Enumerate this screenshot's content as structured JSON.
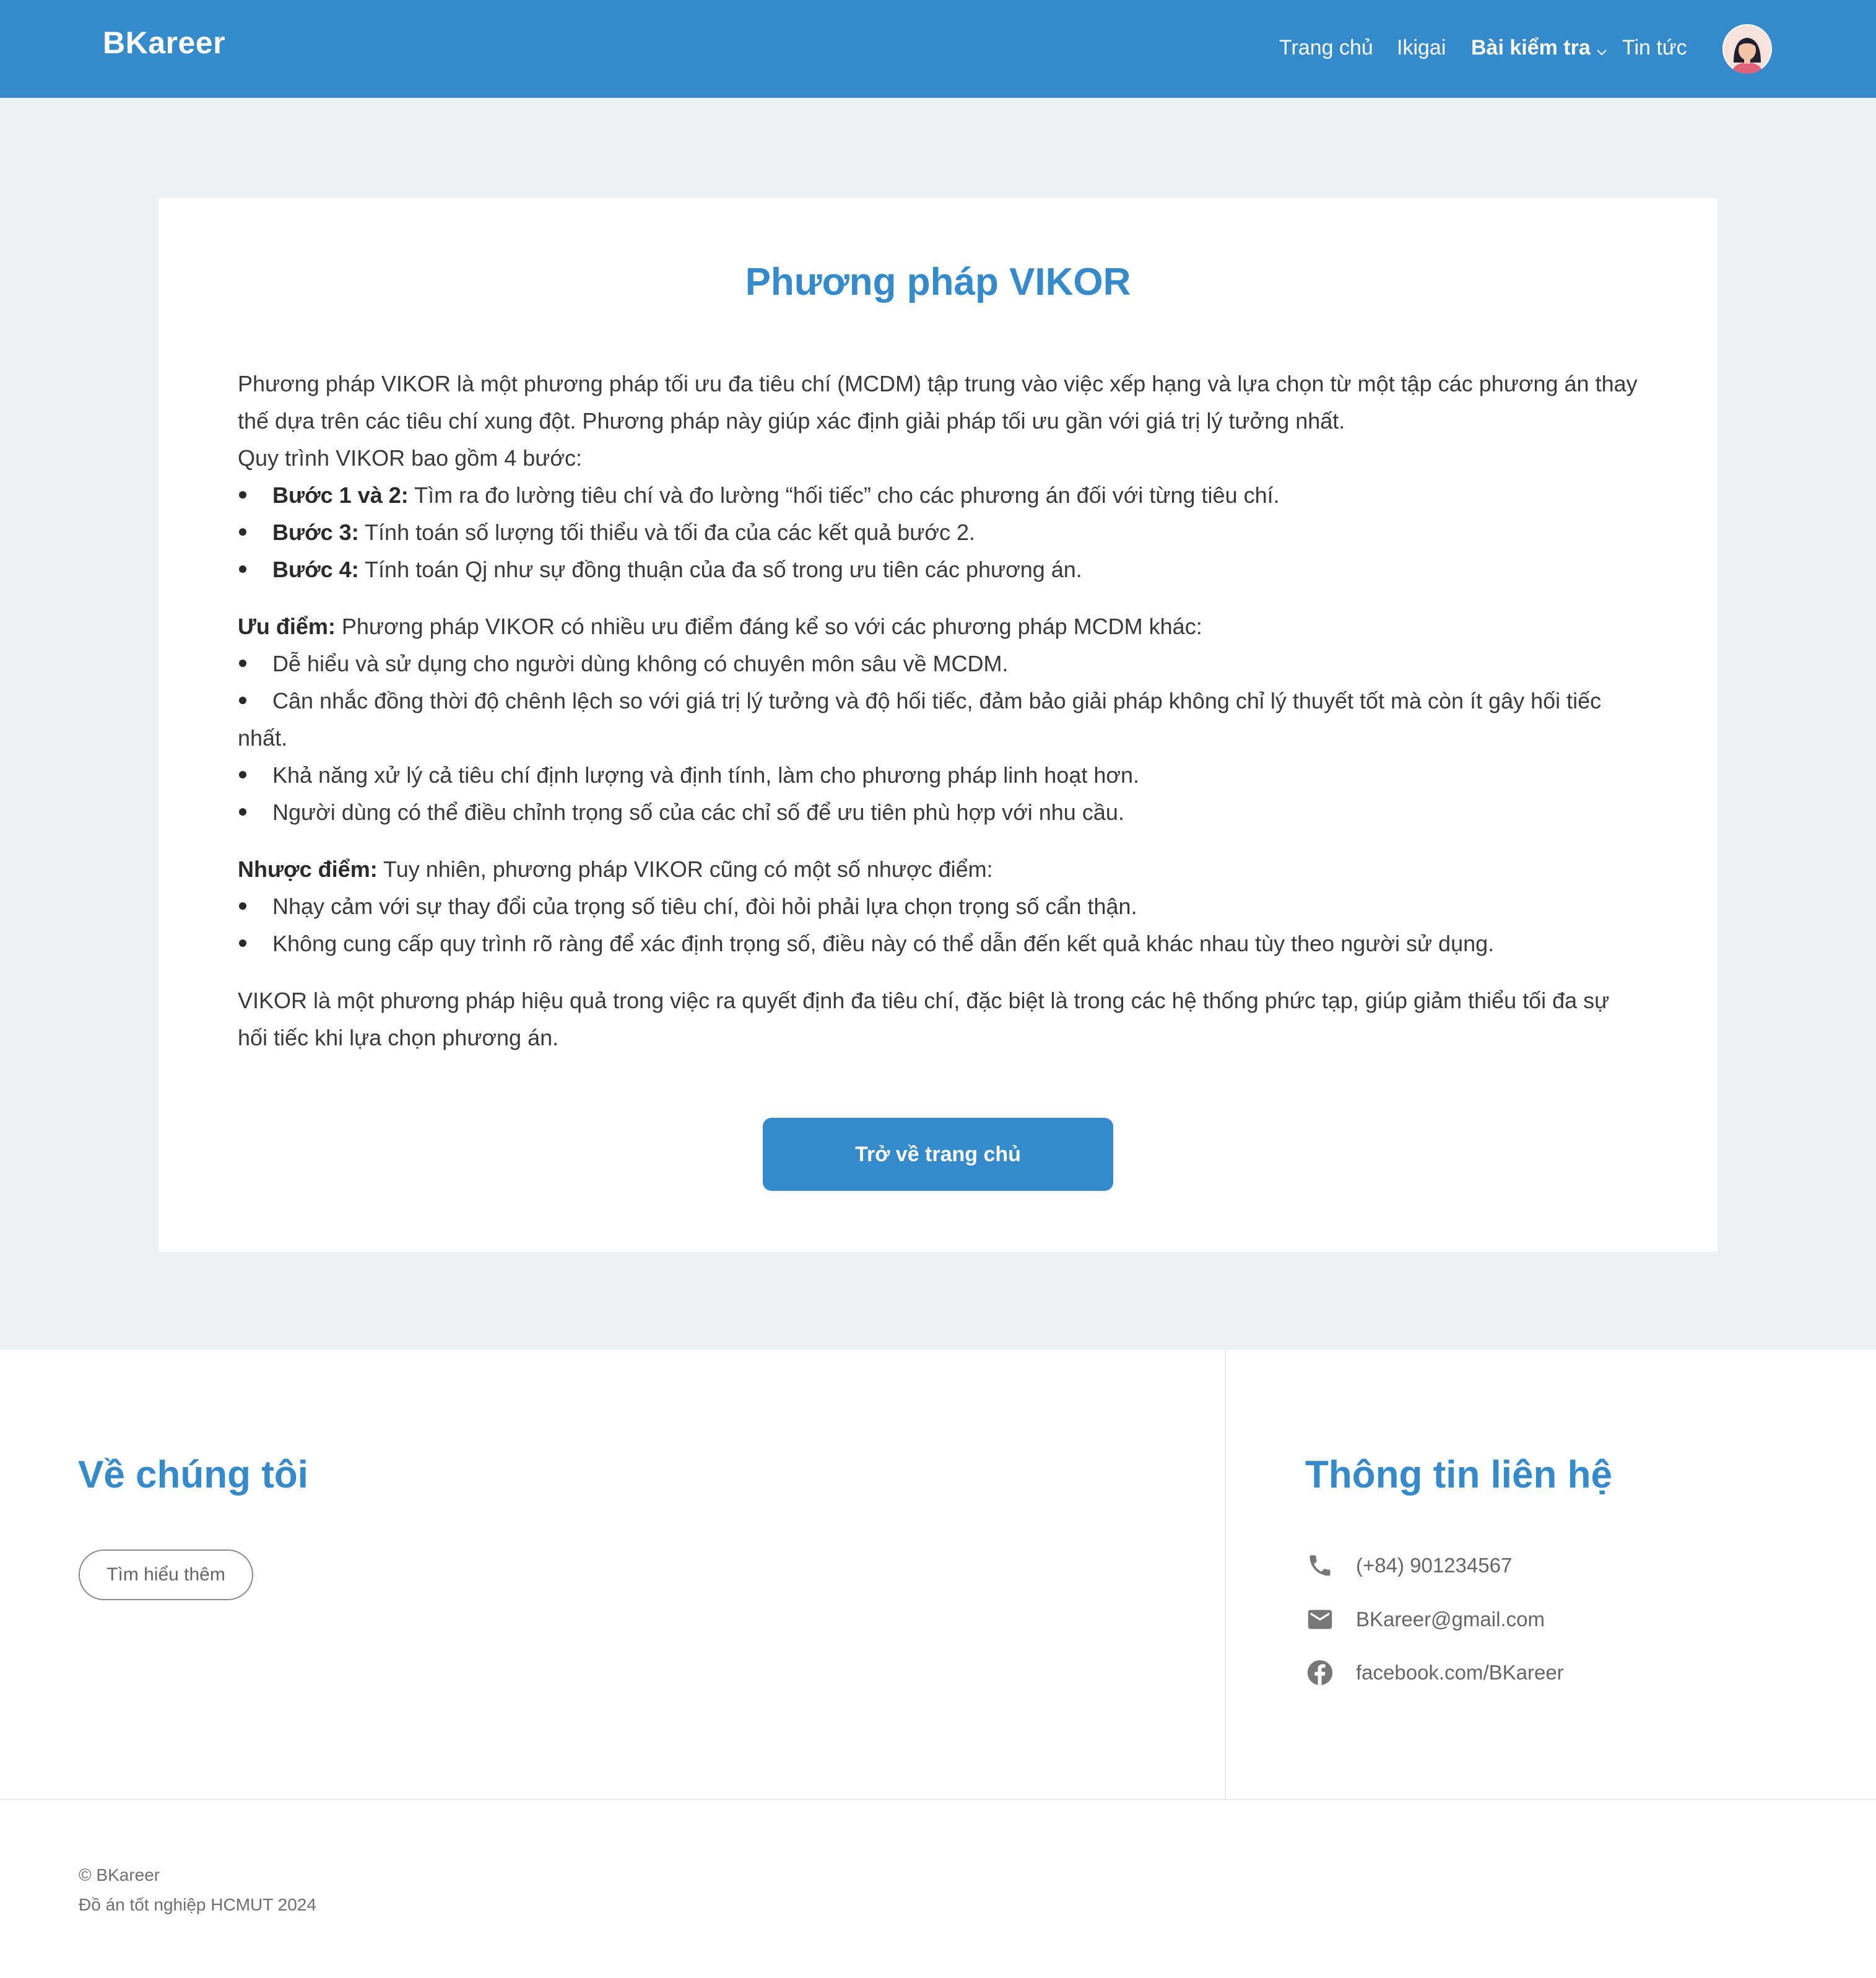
{
  "header": {
    "logo": "BKareer",
    "nav": {
      "home": "Trang chủ",
      "ikigai": "Ikigai",
      "tests": "Bài kiểm tra",
      "news": "Tin tức"
    }
  },
  "article": {
    "title": "Phương pháp VIKOR",
    "intro": "Phương pháp VIKOR là một phương pháp tối ưu đa tiêu chí (MCDM) tập trung vào việc xếp hạng và lựa chọn từ một tập các phương án thay thế dựa trên các tiêu chí xung đột. Phương pháp này giúp xác định giải pháp tối ưu gần với giá trị lý tưởng nhất.",
    "process_heading": "Quy trình VIKOR bao gồm 4 bước:",
    "steps": [
      {
        "label": "Bước 1 và 2:",
        "text": " Tìm ra đo lường tiêu chí và đo lường “hối tiếc” cho các phương án đối với từng tiêu chí."
      },
      {
        "label": "Bước 3:",
        "text": " Tính toán số lượng tối thiểu và tối đa của các kết quả bước 2."
      },
      {
        "label": "Bước 4:",
        "text": " Tính toán Qj như sự đồng thuận của đa số trong ưu tiên các phương án."
      }
    ],
    "pros_label": "Ưu điểm:",
    "pros_text": " Phương pháp VIKOR có nhiều ưu điểm đáng kể so với các phương pháp MCDM khác:",
    "pros": [
      "Dễ hiểu và sử dụng cho người dùng không có chuyên môn sâu về MCDM.",
      "Cân nhắc đồng thời độ chênh lệch so với giá trị lý tưởng và độ hối tiếc, đảm bảo giải pháp không chỉ lý thuyết tốt mà còn ít gây hối tiếc nhất.",
      "Khả năng xử lý cả tiêu chí định lượng và định tính, làm cho phương pháp linh hoạt hơn.",
      "Người dùng có thể điều chỉnh trọng số của các chỉ số để ưu tiên phù hợp với nhu cầu."
    ],
    "cons_label": "Nhược điểm:",
    "cons_text": " Tuy nhiên, phương pháp VIKOR cũng có một số nhược điểm:",
    "cons": [
      "Nhạy cảm với sự thay đổi của trọng số tiêu chí, đòi hỏi phải lựa chọn trọng số cẩn thận.",
      "Không cung cấp quy trình rõ ràng để xác định trọng số, điều này có thể dẫn đến kết quả khác nhau tùy theo người sử dụng."
    ],
    "conclusion": "VIKOR là một phương pháp hiệu quả trong việc ra quyết định đa tiêu chí, đặc biệt là trong các hệ thống phức tạp, giúp giảm thiểu tối đa sự hối tiếc khi lựa chọn phương án.",
    "back_button": "Trở về trang chủ"
  },
  "footer": {
    "about_title": "Về chúng tôi",
    "more_button": "Tìm hiểu thêm",
    "contact_title": "Thông tin liên hệ",
    "phone": "(+84) 901234567",
    "email": "BKareer@gmail.com",
    "facebook": "facebook.com/BKareer",
    "copyright": "© BKareer",
    "project": "Đồ án tốt nghiệp HCMUT 2024"
  },
  "colors": {
    "brand": "#348acb",
    "page_bg": "#ecf0f1"
  }
}
